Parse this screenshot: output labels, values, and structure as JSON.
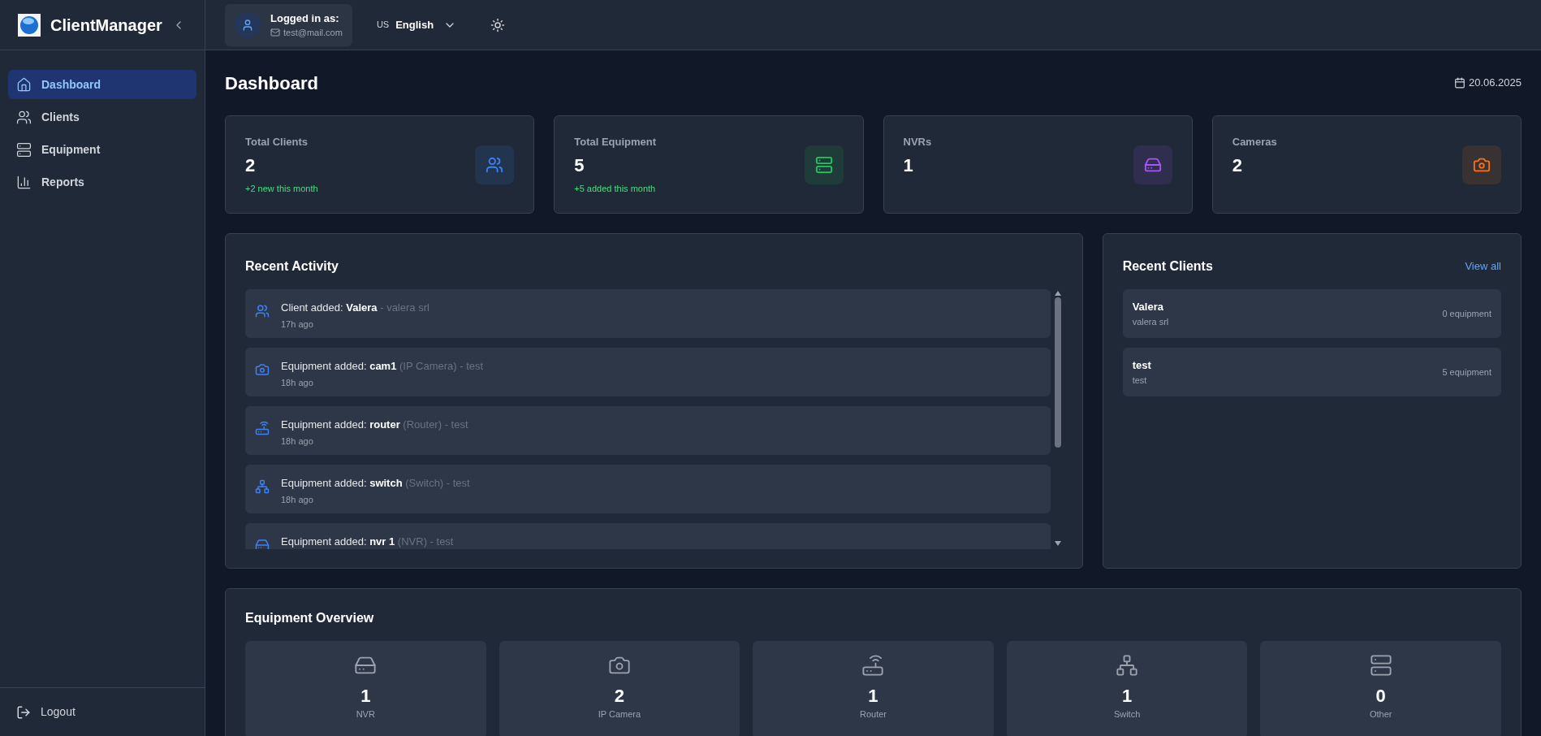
{
  "sidebar": {
    "brand": "ClientManager",
    "items": [
      {
        "label": "Dashboard",
        "kind": "home",
        "selected": true
      },
      {
        "label": "Clients",
        "kind": "users",
        "selected": false
      },
      {
        "label": "Equipment",
        "kind": "server",
        "selected": false
      },
      {
        "label": "Reports",
        "kind": "chart",
        "selected": false
      }
    ],
    "logout": "Logout"
  },
  "topbar": {
    "user": {
      "label": "Logged in as:",
      "email": "test@mail.com"
    },
    "language": {
      "code": "US",
      "label": "English"
    }
  },
  "page": {
    "title": "Dashboard",
    "date": "20.06.2025"
  },
  "stats": [
    {
      "label": "Total Clients",
      "value": "2",
      "note": "+2 new this month",
      "kind": "users",
      "color": "#3b82f6"
    },
    {
      "label": "Total Equipment",
      "value": "5",
      "note": "+5 added this month",
      "kind": "server",
      "color": "#22c55e"
    },
    {
      "label": "NVRs",
      "value": "1",
      "kind": "nvr",
      "color": "#a855f7"
    },
    {
      "label": "Cameras",
      "value": "2",
      "kind": "camera",
      "color": "#f97316"
    }
  ],
  "activity": {
    "title": "Recent Activity",
    "items": [
      {
        "kind": "users",
        "action": "Client added:",
        "name": "Valera",
        "detail": "- valera srl",
        "time": "17h ago"
      },
      {
        "kind": "camera",
        "action": "Equipment added:",
        "name": "cam1",
        "detail": "(IP Camera) - test",
        "time": "18h ago"
      },
      {
        "kind": "router",
        "action": "Equipment added:",
        "name": "router",
        "detail": "(Router) - test",
        "time": "18h ago"
      },
      {
        "kind": "switch",
        "action": "Equipment added:",
        "name": "switch",
        "detail": "(Switch) - test",
        "time": "18h ago"
      },
      {
        "kind": "nvr",
        "action": "Equipment added:",
        "name": "nvr 1",
        "detail": "(NVR) - test"
      }
    ]
  },
  "recent_clients": {
    "title": "Recent Clients",
    "link": "View all",
    "items": [
      {
        "name": "Valera",
        "company": "valera srl",
        "count": "0 equipment"
      },
      {
        "name": "test",
        "company": "test",
        "count": "5 equipment"
      }
    ]
  },
  "overview": {
    "title": "Equipment Overview",
    "items": [
      {
        "kind": "nvr",
        "count": "1",
        "label": "NVR"
      },
      {
        "kind": "camera",
        "count": "2",
        "label": "IP Camera"
      },
      {
        "kind": "router",
        "count": "1",
        "label": "Router"
      },
      {
        "kind": "switch",
        "count": "1",
        "label": "Switch"
      },
      {
        "kind": "server",
        "count": "0",
        "label": "Other"
      }
    ]
  }
}
